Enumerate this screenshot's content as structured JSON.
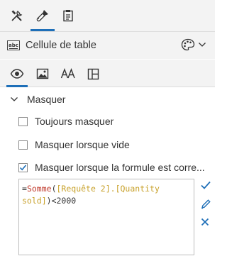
{
  "top_tabs": [
    {
      "icon": "tools-icon"
    },
    {
      "icon": "paintbrush-icon",
      "active": true
    },
    {
      "icon": "clipboard-icon"
    }
  ],
  "header": {
    "badge_text": "abc",
    "title": "Cellule de table",
    "palette_icon": "palette-icon",
    "dropdown_icon": "chevron-down-icon"
  },
  "sub_tabs": [
    {
      "icon": "eye-icon",
      "active": true
    },
    {
      "icon": "image-icon"
    },
    {
      "icon": "text-format-icon"
    },
    {
      "icon": "layout-icon"
    }
  ],
  "section": {
    "title": "Masquer",
    "expanded": true,
    "options": [
      {
        "label": "Toujours masquer",
        "checked": false
      },
      {
        "label": "Masquer lorsque vide",
        "checked": false
      },
      {
        "label": "Masquer lorsque la formule est corre...",
        "checked": true
      }
    ]
  },
  "formula": {
    "line1": {
      "eq": "=",
      "fn": "Somme",
      "open": "(",
      "ref": "[Requête 2].[Quantity"
    },
    "line2": {
      "ref": "sold]",
      "close": ")",
      "rest": "<2000"
    }
  },
  "colors": {
    "accent": "#1e6fb8",
    "formula_function": "#c0392b",
    "formula_reference": "#c8a12a"
  }
}
